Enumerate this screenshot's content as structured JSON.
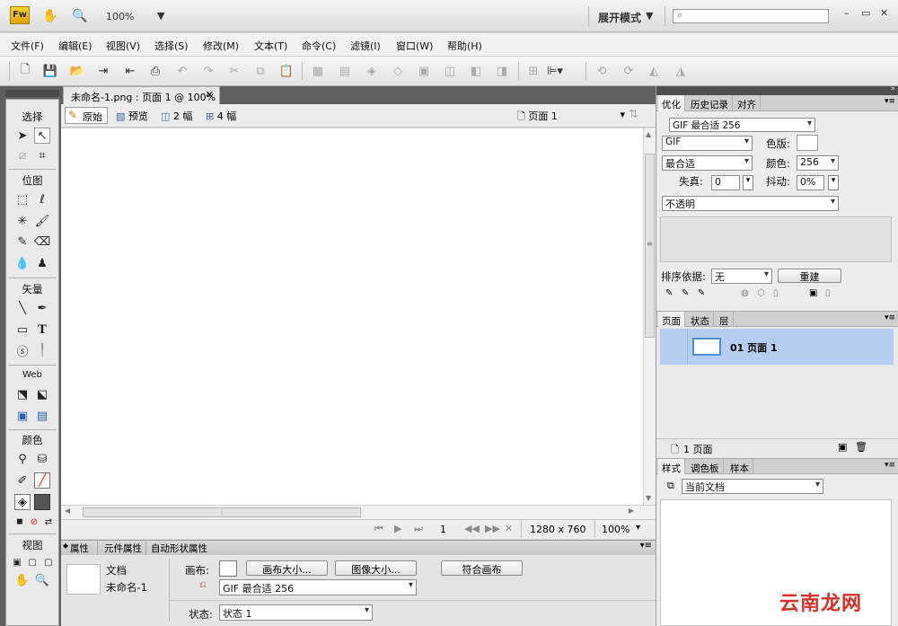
{
  "appbar": {
    "logo": "Fw",
    "zoom_value": "100%",
    "workspace": "展开模式",
    "search_placeholder": ""
  },
  "menus": [
    "文件(F)",
    "编辑(E)",
    "视图(V)",
    "选择(S)",
    "修改(M)",
    "文本(T)",
    "命令(C)",
    "滤镜(I)",
    "窗口(W)",
    "帮助(H)"
  ],
  "tools": {
    "sections": [
      "选择",
      "位图",
      "矢量",
      "Web",
      "颜色",
      "视图"
    ]
  },
  "document": {
    "tab_title": "未命名-1.png : 页面 1 @ 100%",
    "views": [
      "原始",
      "预览",
      "2 幅",
      "4 幅"
    ],
    "page_select": "页面 1"
  },
  "status": {
    "page_number": "1",
    "canvas_size": "1280 x 760",
    "zoom": "100%"
  },
  "properties": {
    "tabs": [
      "属性",
      "元件属性",
      "自动形状属性"
    ],
    "doc_label": "文档",
    "doc_name": "未命名-1",
    "canvas_label": "画布:",
    "canvas_size_btn": "画布大小...",
    "image_size_btn": "图像大小...",
    "fit_canvas_btn": "符合画布",
    "export_setting": "GIF 最合适 256",
    "state_label": "状态:",
    "state_value": "状态 1"
  },
  "optimize_panel": {
    "tabs": [
      "优化",
      "历史记录",
      "对齐"
    ],
    "preset": "GIF 最合适 256",
    "format": "GIF",
    "palette_label": "色版:",
    "palette_type": "最合适",
    "colors_label": "颜色:",
    "colors_value": "256",
    "loss_label": "失真:",
    "loss_value": "0",
    "dither_label": "抖动:",
    "dither_value": "0%",
    "transparency": "不透明",
    "sort_label": "排序依据:",
    "sort_value": "无",
    "rebuild_btn": "重建"
  },
  "pages_panel": {
    "tabs": [
      "页面",
      "状态",
      "层"
    ],
    "page_item": "01 页面 1",
    "footer_count": "1 页面"
  },
  "styles_panel": {
    "tabs": [
      "样式",
      "调色板",
      "样本"
    ],
    "source": "当前文档"
  },
  "watermark": "云南龙网",
  "colors": {
    "accent_page_row": "#b5cdf0",
    "canvas": "#ffffff"
  }
}
